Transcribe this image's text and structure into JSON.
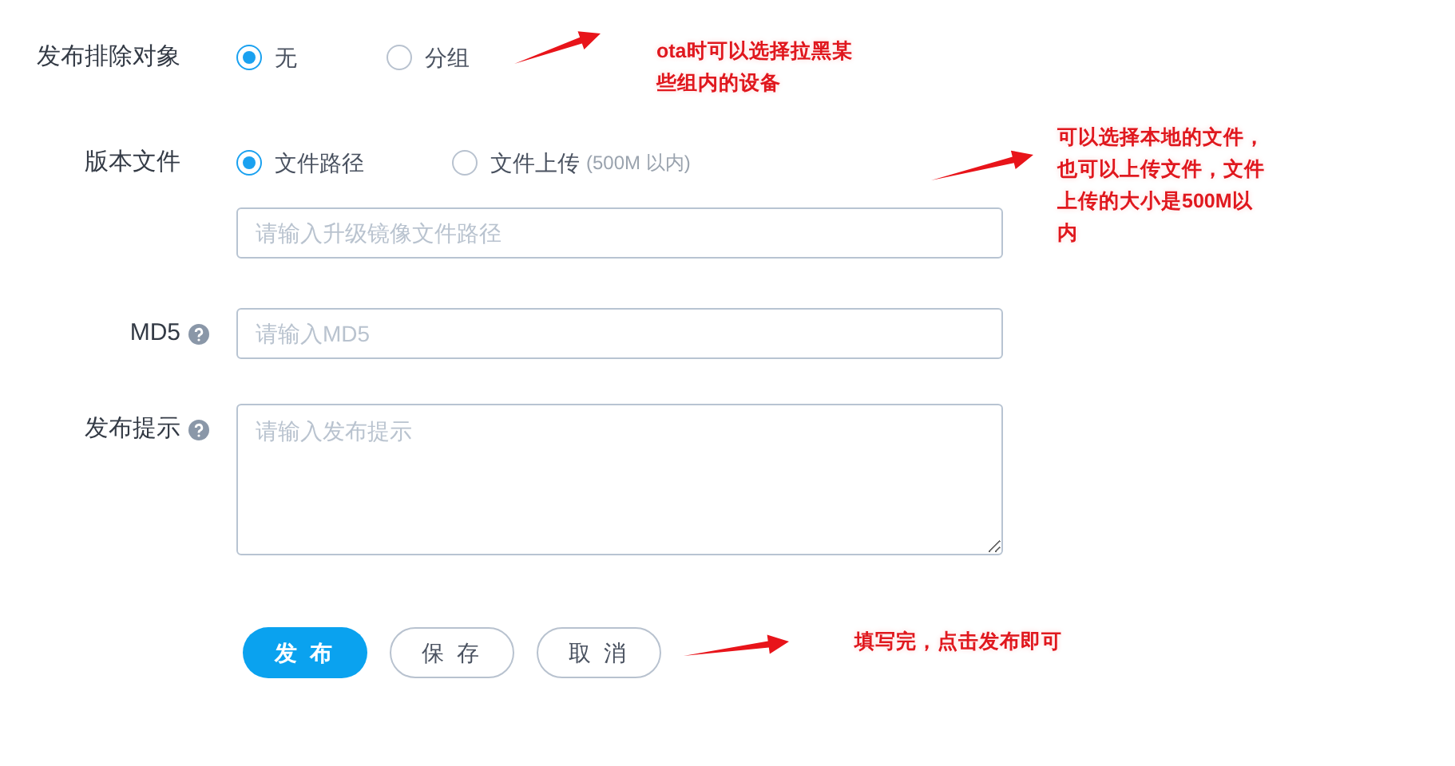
{
  "form": {
    "rows": [
      {
        "kind": "radio",
        "label": "发布排除对象",
        "options": [
          {
            "label": "无",
            "selected": true
          },
          {
            "label": "分组",
            "selected": false
          }
        ]
      },
      {
        "kind": "radio",
        "label": "版本文件",
        "options": [
          {
            "label": "文件路径",
            "selected": true
          },
          {
            "label": "文件上传",
            "note": "(500M 以内)",
            "selected": false
          }
        ],
        "field": {
          "placeholder": "请输入升级镜像文件路径"
        }
      },
      {
        "kind": "input",
        "label": "MD5",
        "help": true,
        "field": {
          "placeholder": "请输入MD5"
        }
      },
      {
        "kind": "textarea",
        "label": "发布提示",
        "help": true,
        "field": {
          "placeholder": "请输入发布提示"
        }
      }
    ],
    "buttons": [
      {
        "label": "发 布",
        "kind": "primary"
      },
      {
        "label": "保 存",
        "kind": "default"
      },
      {
        "label": "取 消",
        "kind": "default"
      }
    ]
  },
  "annotations": [
    {
      "text": "ota时可以选择拉黑某些组内的设备"
    },
    {
      "text": "可以选择本地的文件，也可以上传文件，文件上传的大小是500M以内"
    },
    {
      "text": "填写完，点击发布即可"
    }
  ]
}
